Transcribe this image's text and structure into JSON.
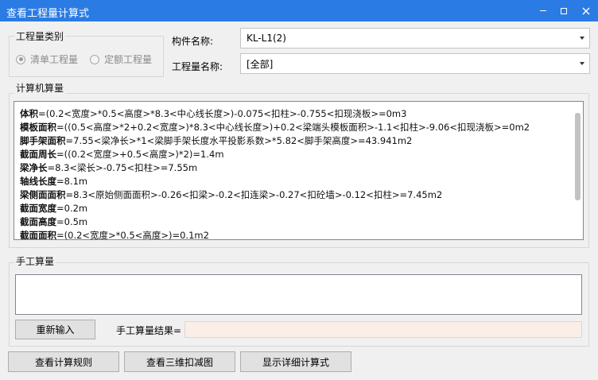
{
  "window": {
    "title": "查看工程量计算式"
  },
  "quantity_category": {
    "group_label": "工程量类别",
    "options": [
      "清单工程量",
      "定额工程量"
    ],
    "selected": "清单工程量"
  },
  "fields": {
    "component_label": "构件名称:",
    "component_value": "KL-L1(2)",
    "quantity_label": "工程量名称:",
    "quantity_value": "[全部]"
  },
  "computer_calc": {
    "group_label": "计算机算量",
    "lines": [
      {
        "name": "体积",
        "formula": "=(0.2<宽度>*0.5<高度>*8.3<中心线长度>)-0.075<扣柱>-0.755<扣现浇板>=0m3"
      },
      {
        "name": "模板面积",
        "formula": "=((0.5<高度>*2+0.2<宽度>)*8.3<中心线长度>)+0.2<梁端头模板面积>-1.1<扣柱>-9.06<扣现浇板>=0m2"
      },
      {
        "name": "脚手架面积",
        "formula": "=7.55<梁净长>*1<梁脚手架长度水平投影系数>*5.82<脚手架高度>=43.941m2"
      },
      {
        "name": "截面周长",
        "formula": "=((0.2<宽度>+0.5<高度>)*2)=1.4m"
      },
      {
        "name": "梁净长",
        "formula": "=8.3<梁长>-0.75<扣柱>=7.55m"
      },
      {
        "name": "轴线长度",
        "formula": "=8.1m"
      },
      {
        "name": "梁侧面面积",
        "formula": "=8.3<原始侧面面积>-0.26<扣梁>-0.2<扣连梁>-0.27<扣砼墙>-0.12<扣柱>=7.45m2"
      },
      {
        "name": "截面宽度",
        "formula": "=0.2m"
      },
      {
        "name": "截面高度",
        "formula": "=0.5m"
      },
      {
        "name": "截面面积",
        "formula": "=(0.2<宽度>*0.5<高度>)=0.1m2"
      }
    ]
  },
  "manual_calc": {
    "group_label": "手工算量",
    "reinput_button": "重新输入",
    "result_label": "手工算量结果=",
    "result_value": ""
  },
  "footer": {
    "rules_button": "查看计算规则",
    "view3d_button": "查看三维扣减图",
    "detail_button": "显示详细计算式"
  }
}
